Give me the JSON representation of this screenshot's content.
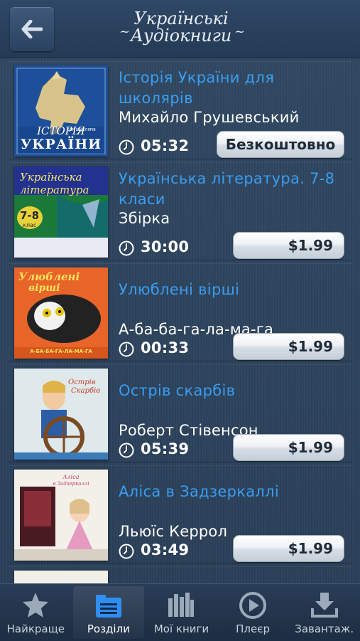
{
  "header": {
    "title_line1": "Українські",
    "title_line2": "Аудіокниги"
  },
  "books": [
    {
      "title": "Історія України для школярів",
      "author": "Михайло Грушевський",
      "duration": "05:32",
      "price": "Безкоштовно",
      "cover_text": [
        "ІСТОРІЯ",
        "УКРАЇНИ",
        "ДЛЯ ШКОЛЯРІВ"
      ]
    },
    {
      "title": "Українська література. 7-8 класи",
      "author": "Збірка",
      "duration": "30:00",
      "price": "$1.99",
      "cover_text": [
        "Українська",
        "література",
        "7-8",
        "клас"
      ]
    },
    {
      "title": "Улюблені вірші",
      "author": "А-ба-ба-га-ла-ма-га",
      "duration": "00:33",
      "price": "$1.99",
      "cover_text": [
        "Улюблені",
        "вірші",
        "А-БА-БА-ГА-ЛА-МА-ГА"
      ]
    },
    {
      "title": "Острів скарбів",
      "author": "Роберт Стівенсон",
      "duration": "05:39",
      "price": "$1.99",
      "cover_text": [
        "Острів",
        "Скарбів"
      ]
    },
    {
      "title": "Аліса в Задзеркаллі",
      "author": "Льюїс Керрол",
      "duration": "03:49",
      "price": "$1.99",
      "cover_text": [
        "Аліса",
        "в Задзеркаллі"
      ]
    }
  ],
  "tabs": [
    {
      "label": "Найкраще",
      "icon": "star-icon"
    },
    {
      "label": "Розділи",
      "icon": "sections-icon"
    },
    {
      "label": "Мої книги",
      "icon": "books-icon"
    },
    {
      "label": "Плеєр",
      "icon": "play-icon"
    },
    {
      "label": "Завантаж.",
      "icon": "download-icon"
    }
  ],
  "colors": {
    "title_blue": "#3a9df0",
    "background": "#2b3f57",
    "active_tab_icon": "#2f8ff0"
  }
}
